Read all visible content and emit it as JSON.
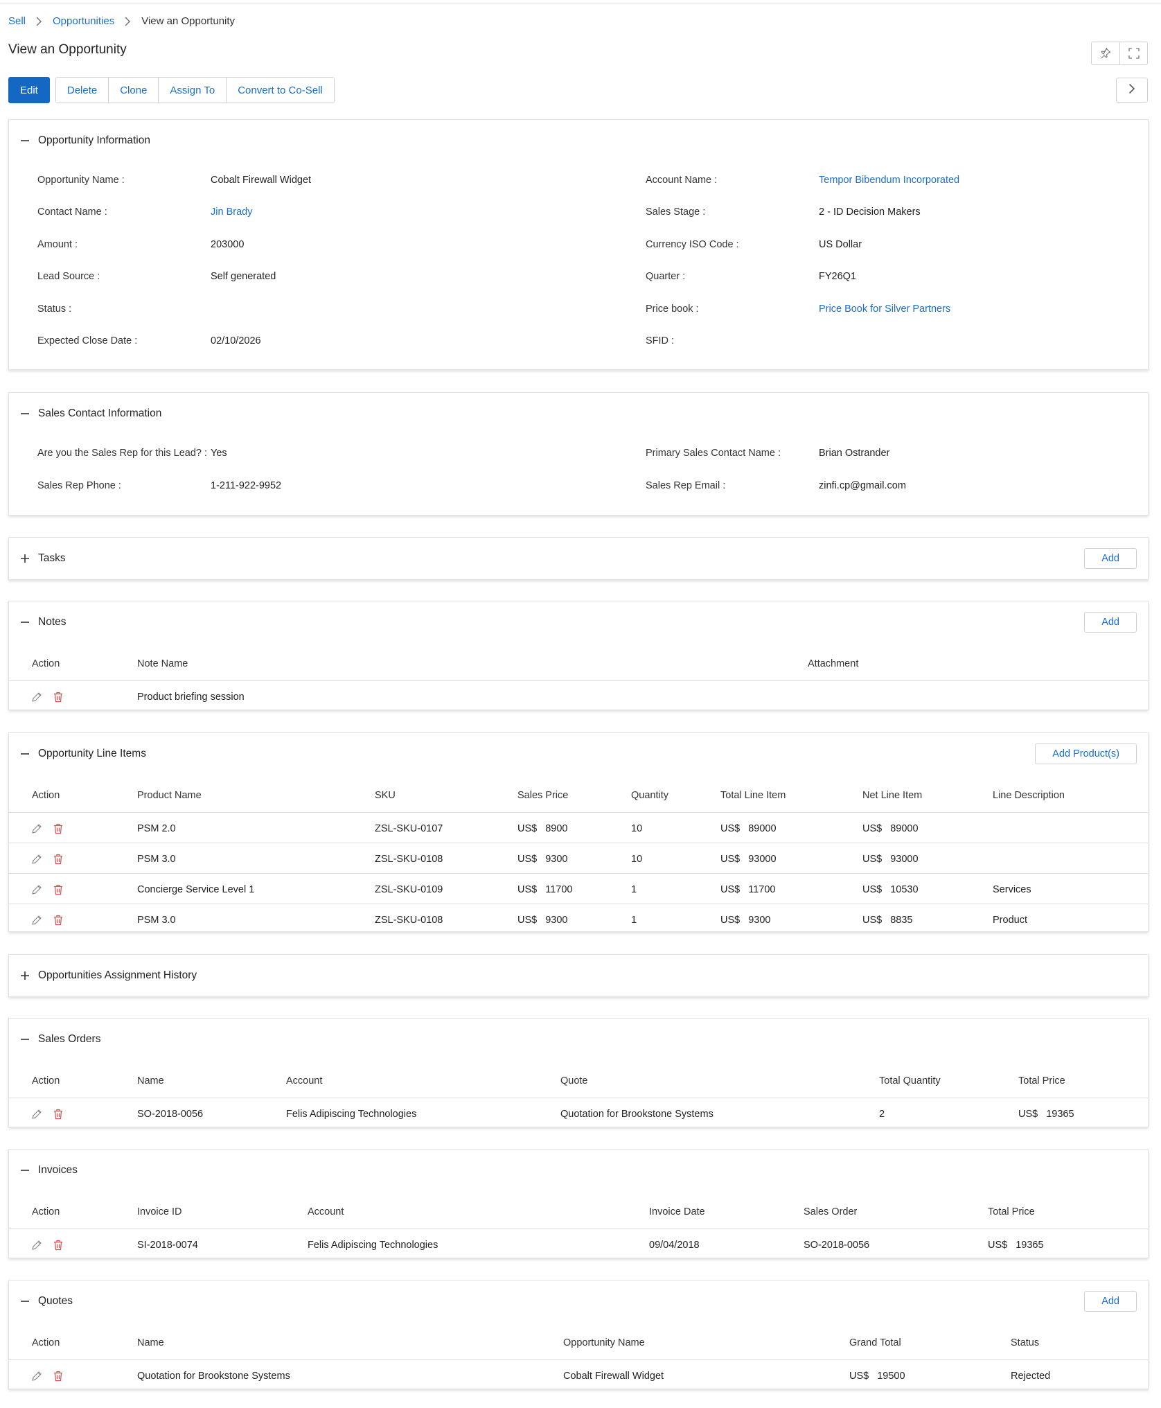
{
  "breadcrumb": {
    "sell": "Sell",
    "opportunities": "Opportunities",
    "current": "View an Opportunity"
  },
  "page_title": "View an Opportunity",
  "toolbar": {
    "edit": "Edit",
    "delete": "Delete",
    "clone": "Clone",
    "assign_to": "Assign To",
    "convert": "Convert to Co-Sell"
  },
  "colors": {
    "accent": "#1467c2",
    "link": "#1a6fc9",
    "delete_icon": "#e0484c"
  },
  "opportunity_info": {
    "title": "Opportunity Information",
    "opportunity_name_label": "Opportunity Name :",
    "opportunity_name": "Cobalt Firewall Widget",
    "contact_name_label": "Contact Name :",
    "contact_name": "Jin Brady",
    "amount_label": "Amount :",
    "amount": "203000",
    "lead_source_label": "Lead Source :",
    "lead_source": "Self generated",
    "status_label": "Status :",
    "status": "",
    "expected_close_label": "Expected Close Date :",
    "expected_close": "02/10/2026",
    "account_name_label": "Account Name :",
    "account_name": "Tempor Bibendum Incorporated",
    "sales_stage_label": "Sales Stage :",
    "sales_stage": "2 - ID Decision Makers",
    "currency_label": "Currency ISO Code :",
    "currency": "US Dollar",
    "quarter_label": "Quarter :",
    "quarter": "FY26Q1",
    "price_book_label": "Price book :",
    "price_book": "Price Book for Silver Partners",
    "sfid_label": "SFID :",
    "sfid": ""
  },
  "sales_contact": {
    "title": "Sales Contact Information",
    "sales_rep_q_label": "Are you the Sales Rep for this Lead? :",
    "sales_rep_q": "Yes",
    "phone_label": "Sales Rep Phone :",
    "phone": "1-211-922-9952",
    "primary_label": "Primary Sales Contact Name :",
    "primary": "Brian Ostrander",
    "email_label": "Sales Rep Email :",
    "email": "zinfi.cp@gmail.com"
  },
  "tasks": {
    "title": "Tasks",
    "add": "Add"
  },
  "notes": {
    "title": "Notes",
    "add": "Add",
    "headers": {
      "action": "Action",
      "note_name": "Note Name",
      "attachment": "Attachment"
    },
    "rows": [
      {
        "note_name": "Product briefing session",
        "attachment": ""
      }
    ]
  },
  "line_items": {
    "title": "Opportunity Line Items",
    "add": "Add Product(s)",
    "headers": {
      "action": "Action",
      "product_name": "Product Name",
      "sku": "SKU",
      "sales_price": "Sales Price",
      "quantity": "Quantity",
      "total": "Total Line Item",
      "net": "Net Line Item",
      "desc": "Line Description"
    },
    "rows": [
      {
        "product": "PSM 2.0",
        "sku": "ZSL-SKU-0107",
        "cur": "US$",
        "price": "8900",
        "qty": "10",
        "total": "89000",
        "net": "89000",
        "desc": ""
      },
      {
        "product": "PSM 3.0",
        "sku": "ZSL-SKU-0108",
        "cur": "US$",
        "price": "9300",
        "qty": "10",
        "total": "93000",
        "net": "93000",
        "desc": ""
      },
      {
        "product": "Concierge Service Level 1",
        "sku": "ZSL-SKU-0109",
        "cur": "US$",
        "price": "11700",
        "qty": "1",
        "total": "11700",
        "net": "10530",
        "desc": "Services"
      },
      {
        "product": "PSM 3.0",
        "sku": "ZSL-SKU-0108",
        "cur": "US$",
        "price": "9300",
        "qty": "1",
        "total": "9300",
        "net": "8835",
        "desc": "Product"
      }
    ]
  },
  "assignment_history": {
    "title": "Opportunities Assignment History"
  },
  "sales_orders": {
    "title": "Sales Orders",
    "headers": {
      "action": "Action",
      "name": "Name",
      "account": "Account",
      "quote": "Quote",
      "total_qty": "Total Quantity",
      "total_price": "Total Price"
    },
    "rows": [
      {
        "name": "SO-2018-0056",
        "account": "Felis Adipiscing Technologies",
        "quote": "Quotation for Brookstone Systems",
        "qty": "2",
        "cur": "US$",
        "price": "19365"
      }
    ]
  },
  "invoices": {
    "title": "Invoices",
    "headers": {
      "action": "Action",
      "invoice_id": "Invoice ID",
      "account": "Account",
      "date": "Invoice Date",
      "sales_order": "Sales Order",
      "total_price": "Total Price"
    },
    "rows": [
      {
        "id": "SI-2018-0074",
        "account": "Felis Adipiscing Technologies",
        "date": "09/04/2018",
        "so": "SO-2018-0056",
        "cur": "US$",
        "price": "19365"
      }
    ]
  },
  "quotes": {
    "title": "Quotes",
    "add": "Add",
    "headers": {
      "action": "Action",
      "name": "Name",
      "opp_name": "Opportunity Name",
      "grand_total": "Grand Total",
      "status": "Status"
    },
    "rows": [
      {
        "name": "Quotation for Brookstone Systems",
        "opp": "Cobalt Firewall Widget",
        "cur": "US$",
        "total": "19500",
        "status": "Rejected"
      }
    ]
  }
}
